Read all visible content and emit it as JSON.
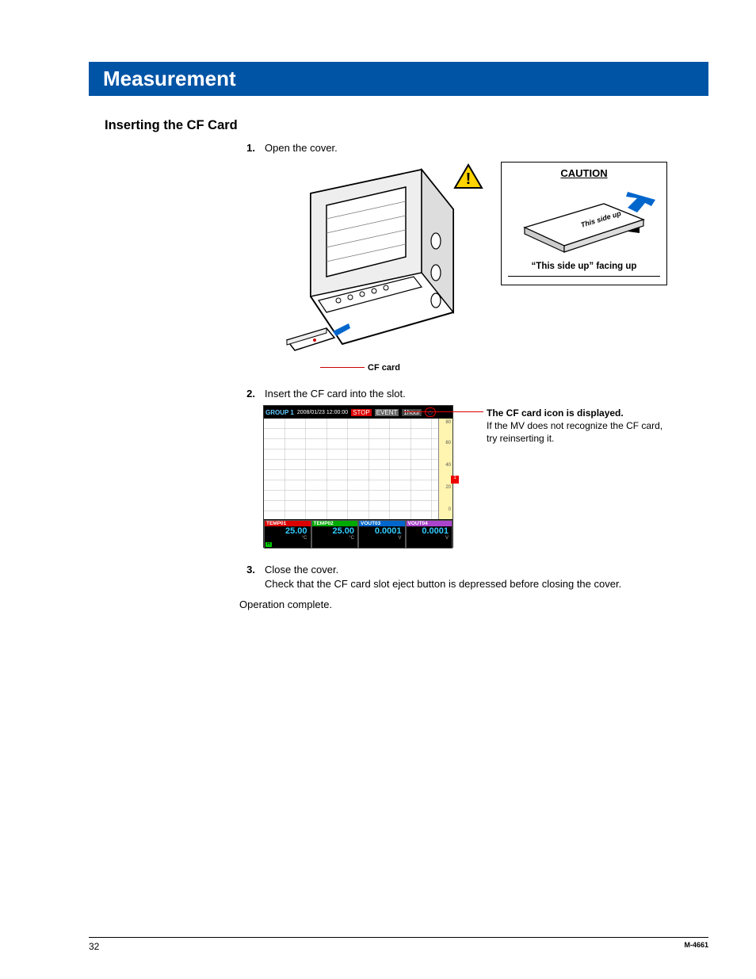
{
  "title": "Measurement",
  "section_heading": "Inserting the CF Card",
  "steps": {
    "s1_num": "1.",
    "s1_text": "Open the cover.",
    "s2_num": "2.",
    "s2_text": "Insert the CF card into the slot.",
    "s3_num": "3.",
    "s3_text": "Close the cover.",
    "s3_text2": "Check that the CF card slot eject button is depressed before closing the cover."
  },
  "fig1": {
    "cf_label": "CF card",
    "caution_head": "CAUTION",
    "caution_card_text": "This side up",
    "caution_sub": "“This side up” facing up"
  },
  "screen": {
    "group": "GROUP 1",
    "timestamp": "2008/01/23 12:00:00",
    "stop": "STOP",
    "event": "EVENT",
    "interval": "1hour",
    "cf_glyph": "◇",
    "yticks": {
      "t0": "80",
      "t1": "60",
      "t2": "40",
      "t3": "20",
      "t4": "0"
    },
    "alarm": "1",
    "h_badge": "H",
    "readings": [
      {
        "label": "TEMP01",
        "value": "25.00",
        "unit": "°C"
      },
      {
        "label": "TEMP02",
        "value": "25.00",
        "unit": "°C"
      },
      {
        "label": "VOUT03",
        "value": "0.0001",
        "unit": "V"
      },
      {
        "label": "VOUT04",
        "value": "0.0001",
        "unit": "V"
      }
    ]
  },
  "annotation": {
    "bold": "The CF card icon is displayed.",
    "line2": "If the MV does not recognize the CF card, try reinserting it."
  },
  "completion": "Operation complete.",
  "footer": {
    "page": "32",
    "doc": "M-4661"
  }
}
